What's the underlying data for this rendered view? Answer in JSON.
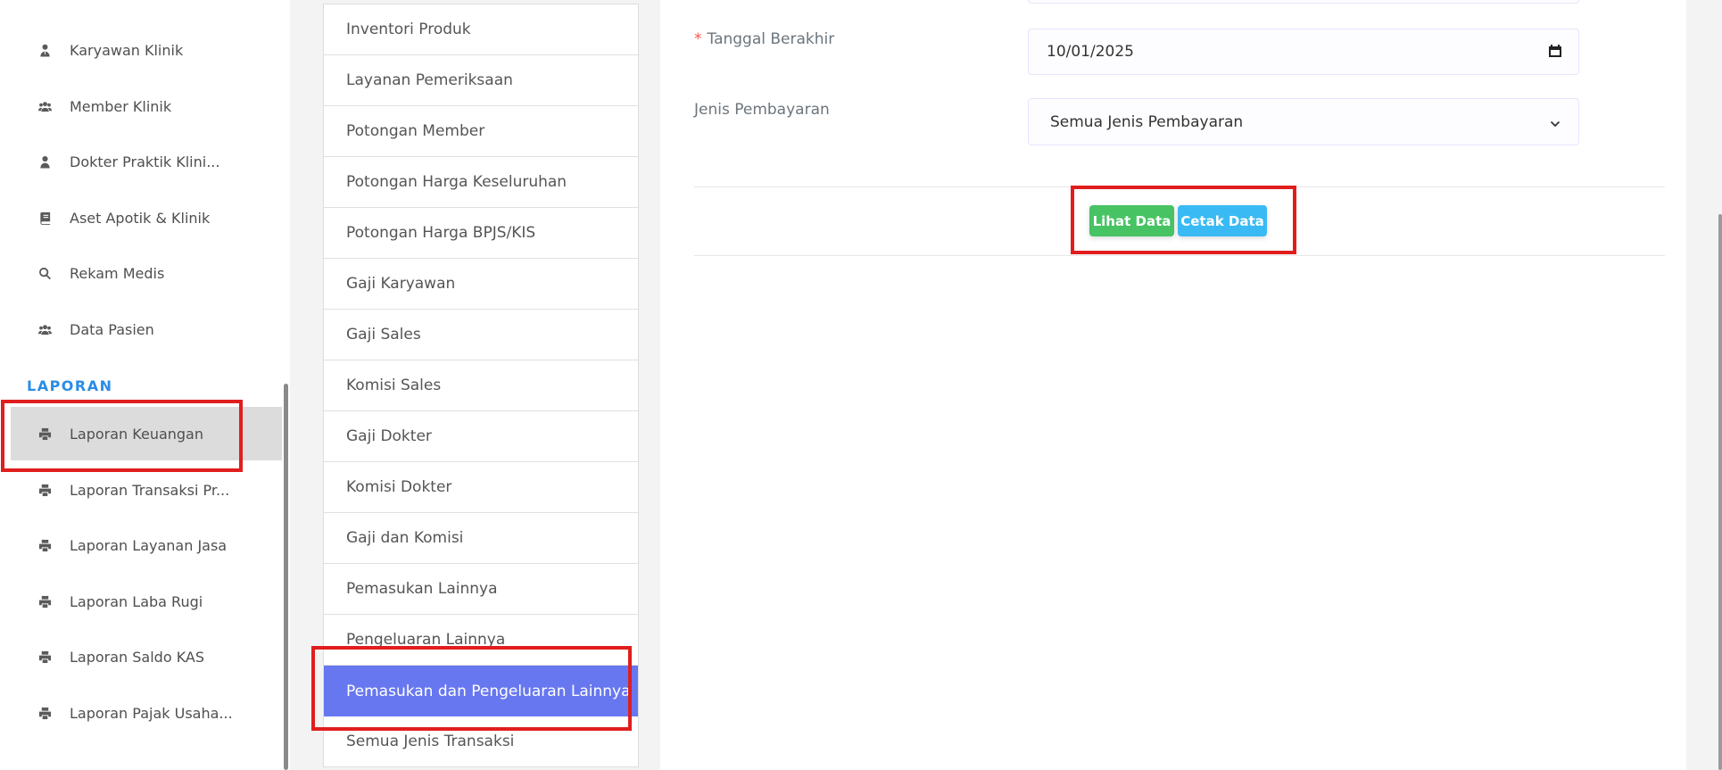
{
  "sidebar": {
    "items": [
      {
        "label": "Karyawan Klinik",
        "icon": "user-tie-icon"
      },
      {
        "label": "Member Klinik",
        "icon": "users-icon"
      },
      {
        "label": "Dokter Praktik Klini...",
        "icon": "user-icon"
      },
      {
        "label": "Aset Apotik & Klinik",
        "icon": "book-icon"
      },
      {
        "label": "Rekam Medis",
        "icon": "search-icon"
      },
      {
        "label": "Data Pasien",
        "icon": "users-icon"
      }
    ],
    "section_title": "LAPORAN",
    "report_items": [
      {
        "label": "Laporan Keuangan",
        "icon": "print-icon",
        "active": true
      },
      {
        "label": "Laporan Transaksi Pr...",
        "icon": "print-icon"
      },
      {
        "label": "Laporan Layanan Jasa",
        "icon": "print-icon"
      },
      {
        "label": "Laporan Laba Rugi",
        "icon": "print-icon"
      },
      {
        "label": "Laporan Saldo KAS",
        "icon": "print-icon"
      },
      {
        "label": "Laporan Pajak Usaha...",
        "icon": "print-icon"
      }
    ]
  },
  "report_types": {
    "items": [
      "Inventori Produk",
      "Layanan Pemeriksaan",
      "Potongan Member",
      "Potongan Harga Keseluruhan",
      "Potongan Harga BPJS/KIS",
      "Gaji Karyawan",
      "Gaji Sales",
      "Komisi Sales",
      "Gaji Dokter",
      "Komisi Dokter",
      "Gaji dan Komisi",
      "Pemasukan Lainnya",
      "Pengeluaran Lainnya",
      "Pemasukan dan Pengeluaran Lainnya",
      "Semua Jenis Transaksi"
    ],
    "active": "Pemasukan dan Pengeluaran Lainnya"
  },
  "form": {
    "required_mark": "*",
    "end_date_label": "Tanggal Berakhir",
    "end_date_value": "10/01/2025",
    "payment_label": "Jenis Pembayaran",
    "payment_value": "Semua Jenis Pembayaran"
  },
  "actions": {
    "view_label": "Lihat Data",
    "print_label": "Cetak Data"
  },
  "colors": {
    "accent": "#6777ef",
    "section": "#2a8ce6",
    "success": "#47c363",
    "info": "#3abaf4",
    "highlight": "#e01e1e"
  }
}
